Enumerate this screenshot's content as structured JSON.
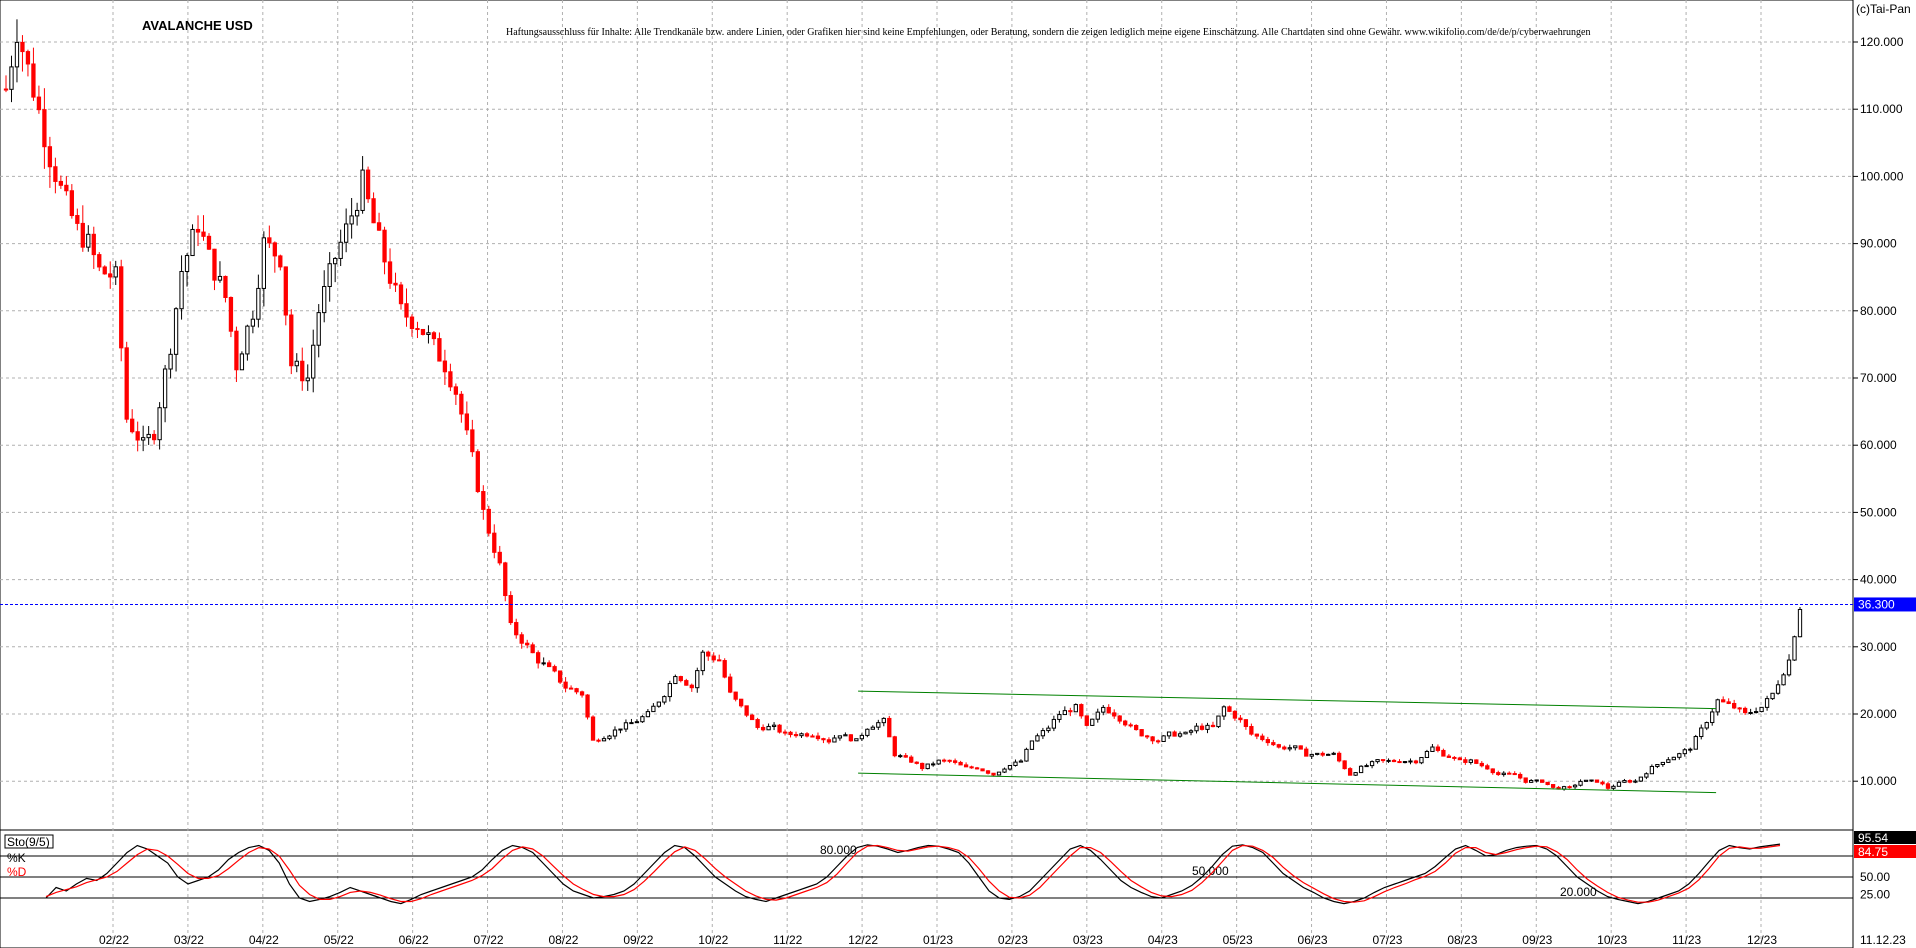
{
  "chart_data": [
    {
      "type": "candlestick",
      "title": "AVALANCHE USD",
      "copyright": "(c)Tai-Pan",
      "disclaimer": "Haftungsausschluss für Inhalte: Alle Trendkanäle bzw. andere Linien, oder Grafiken hier sind keine Empfehlungen, oder Beratung, sondern die zeigen lediglich meine eigene Einschätzung. Alle Chartdaten sind ohne Gewähr. www.wikifolio.com/de/de/p/cyberwaehrungen",
      "y_ticks": [
        "120.000",
        "110.000",
        "100.000",
        "90.000",
        "80.000",
        "70.000",
        "60.000",
        "50.000",
        "40.000",
        "30.000",
        "20.000",
        "10.000"
      ],
      "ylim": [
        0,
        125
      ],
      "x_ticks": [
        "02/22",
        "03/22",
        "04/22",
        "05/22",
        "06/22",
        "07/22",
        "08/22",
        "09/22",
        "10/22",
        "11/22",
        "12/22",
        "01/23",
        "02/23",
        "03/23",
        "04/23",
        "05/23",
        "06/23",
        "07/23",
        "08/23",
        "09/23",
        "10/23",
        "11/23",
        "12/23"
      ],
      "last_date": "11.12.23",
      "current_price": "36.300",
      "current_price_value": 36.3,
      "up_color": "#000000",
      "down_color": "#ff0000",
      "price_line_color": "#0000ff",
      "price_label_bg": "#0000ff",
      "trendline_color": "#008000",
      "trendlines": [
        {
          "x": [
            "12/22",
            "11/23"
          ],
          "y": [
            23.4,
            20.8
          ]
        },
        {
          "x": [
            "12/22",
            "11/23"
          ],
          "y": [
            11.2,
            8.3
          ]
        }
      ],
      "price_path": [
        [
          0,
          113
        ],
        [
          2,
          122
        ],
        [
          5,
          113
        ],
        [
          8,
          103
        ],
        [
          10,
          98
        ],
        [
          13,
          92
        ],
        [
          15,
          90
        ],
        [
          17,
          86
        ],
        [
          20,
          85
        ],
        [
          22,
          64
        ],
        [
          25,
          60
        ],
        [
          27,
          62
        ],
        [
          30,
          75
        ],
        [
          32,
          86
        ],
        [
          35,
          93
        ],
        [
          37,
          88
        ],
        [
          40,
          82
        ],
        [
          42,
          72
        ],
        [
          45,
          80
        ],
        [
          47,
          90
        ],
        [
          50,
          88
        ],
        [
          52,
          72
        ],
        [
          55,
          70
        ],
        [
          57,
          80
        ],
        [
          60,
          88
        ],
        [
          62,
          92
        ],
        [
          65,
          99
        ],
        [
          67,
          93
        ],
        [
          70,
          85
        ],
        [
          72,
          80
        ],
        [
          75,
          78
        ],
        [
          77,
          76
        ],
        [
          80,
          72
        ],
        [
          82,
          68
        ],
        [
          85,
          58
        ],
        [
          87,
          50
        ],
        [
          90,
          42
        ],
        [
          92,
          33
        ],
        [
          95,
          30
        ],
        [
          97,
          28
        ],
        [
          100,
          26
        ],
        [
          102,
          24
        ],
        [
          105,
          23
        ],
        [
          107,
          16
        ],
        [
          110,
          17
        ],
        [
          112,
          18
        ],
        [
          115,
          19
        ],
        [
          117,
          20
        ],
        [
          120,
          23
        ],
        [
          122,
          26
        ],
        [
          125,
          24
        ],
        [
          127,
          29
        ],
        [
          130,
          28
        ],
        [
          132,
          23
        ],
        [
          135,
          20
        ],
        [
          137,
          18
        ],
        [
          140,
          18
        ],
        [
          142,
          17
        ],
        [
          145,
          17
        ],
        [
          147,
          17
        ],
        [
          150,
          16
        ],
        [
          152,
          17
        ],
        [
          155,
          16
        ],
        [
          157,
          18
        ],
        [
          160,
          19
        ],
        [
          162,
          14
        ],
        [
          165,
          13
        ],
        [
          167,
          12
        ],
        [
          170,
          13
        ],
        [
          172,
          13
        ],
        [
          175,
          12
        ],
        [
          177,
          12
        ],
        [
          180,
          11
        ],
        [
          182,
          12
        ],
        [
          185,
          13
        ],
        [
          187,
          16
        ],
        [
          190,
          18
        ],
        [
          192,
          20
        ],
        [
          195,
          21
        ],
        [
          197,
          18
        ],
        [
          200,
          21
        ],
        [
          202,
          20
        ],
        [
          205,
          18
        ],
        [
          207,
          17
        ],
        [
          210,
          16
        ],
        [
          212,
          17
        ],
        [
          215,
          17
        ],
        [
          217,
          18
        ],
        [
          220,
          18
        ],
        [
          222,
          21
        ],
        [
          225,
          19
        ],
        [
          227,
          17
        ],
        [
          230,
          16
        ],
        [
          232,
          15
        ],
        [
          235,
          15
        ],
        [
          237,
          14
        ],
        [
          240,
          14
        ],
        [
          242,
          14
        ],
        [
          245,
          11
        ],
        [
          247,
          12
        ],
        [
          250,
          13
        ],
        [
          252,
          13
        ],
        [
          255,
          13
        ],
        [
          257,
          13
        ],
        [
          260,
          15
        ],
        [
          262,
          14
        ],
        [
          265,
          13
        ],
        [
          267,
          13
        ],
        [
          270,
          12
        ],
        [
          272,
          11
        ],
        [
          275,
          11
        ],
        [
          277,
          10
        ],
        [
          280,
          10
        ],
        [
          282,
          9
        ],
        [
          285,
          9
        ],
        [
          287,
          10
        ],
        [
          290,
          10
        ],
        [
          292,
          9
        ],
        [
          295,
          10
        ],
        [
          297,
          10
        ],
        [
          300,
          12
        ],
        [
          302,
          13
        ],
        [
          305,
          14
        ],
        [
          307,
          15
        ],
        [
          310,
          19
        ],
        [
          312,
          22
        ],
        [
          315,
          21
        ],
        [
          317,
          20
        ],
        [
          320,
          21
        ],
        [
          322,
          23
        ],
        [
          325,
          28
        ],
        [
          327,
          36
        ]
      ],
      "candle_count": 328
    },
    {
      "type": "line",
      "indicator": "Sto(9/5)",
      "series": [
        {
          "name": "%K",
          "color": "#000000",
          "values": [
            20,
            35,
            30,
            40,
            48,
            45,
            55,
            70,
            85,
            95,
            90,
            80,
            70,
            50,
            40,
            45,
            50,
            60,
            75,
            85,
            92,
            95,
            88,
            70,
            40,
            20,
            15,
            18,
            22,
            28,
            35,
            30,
            25,
            20,
            15,
            12,
            18,
            25,
            30,
            35,
            40,
            45,
            50,
            60,
            75,
            88,
            95,
            92,
            85,
            70,
            55,
            40,
            30,
            25,
            20,
            22,
            25,
            30,
            40,
            55,
            70,
            85,
            95,
            92,
            80,
            65,
            50,
            40,
            30,
            22,
            18,
            15,
            20,
            25,
            30,
            35,
            40,
            50,
            65,
            80,
            92,
            96,
            94,
            90,
            85,
            88,
            92,
            95,
            94,
            90,
            85,
            70,
            50,
            30,
            20,
            18,
            22,
            30,
            45,
            60,
            75,
            90,
            95,
            88,
            75,
            60,
            45,
            35,
            28,
            22,
            20,
            25,
            30,
            38,
            50,
            65,
            82,
            94,
            96,
            92,
            85,
            70,
            55,
            45,
            35,
            28,
            20,
            15,
            12,
            15,
            20,
            28,
            35,
            40,
            45,
            50,
            55,
            65,
            78,
            90,
            95,
            88,
            80,
            82,
            88,
            92,
            94,
            95,
            90,
            80,
            65,
            50,
            40,
            30,
            22,
            18,
            15,
            12,
            15,
            20,
            25,
            30,
            40,
            55,
            72,
            88,
            95,
            92,
            90,
            93,
            95,
            97
          ]
        },
        {
          "name": "%D",
          "color": "#ff0000",
          "values": [
            22,
            28,
            32,
            36,
            42,
            46,
            50,
            58,
            70,
            82,
            90,
            88,
            80,
            68,
            55,
            48,
            48,
            52,
            62,
            74,
            85,
            92,
            90,
            80,
            60,
            38,
            25,
            18,
            18,
            22,
            28,
            30,
            28,
            24,
            19,
            15,
            15,
            19,
            25,
            30,
            35,
            40,
            45,
            52,
            62,
            76,
            88,
            93,
            90,
            80,
            66,
            52,
            40,
            32,
            25,
            22,
            22,
            25,
            32,
            44,
            58,
            73,
            86,
            93,
            88,
            76,
            62,
            50,
            40,
            30,
            23,
            18,
            17,
            20,
            25,
            30,
            35,
            42,
            54,
            70,
            85,
            94,
            95,
            92,
            88,
            87,
            90,
            93,
            94,
            92,
            88,
            78,
            62,
            44,
            30,
            21,
            20,
            24,
            35,
            50,
            65,
            80,
            92,
            92,
            85,
            72,
            58,
            45,
            36,
            28,
            23,
            22,
            25,
            31,
            42,
            56,
            72,
            88,
            95,
            94,
            88,
            78,
            64,
            52,
            42,
            34,
            26,
            19,
            15,
            14,
            16,
            22,
            29,
            35,
            40,
            46,
            51,
            58,
            70,
            84,
            92,
            92,
            85,
            82,
            85,
            89,
            92,
            94,
            93,
            86,
            75,
            60,
            47,
            37,
            28,
            21,
            17,
            14,
            14,
            17,
            22,
            27,
            34,
            46,
            62,
            80,
            91,
            93,
            91,
            91,
            93,
            95
          ]
        }
      ],
      "ylim": [
        0,
        110
      ],
      "levels": [
        {
          "value": 80,
          "label": "80.000"
        },
        {
          "value": 50,
          "label": "50.000"
        },
        {
          "value": 20,
          "label": "20.000"
        }
      ],
      "y_ticks": [
        "50.00",
        "25.00"
      ],
      "k_label": "%K",
      "d_label": "%D",
      "last_k": "95.54",
      "last_d": "84.75"
    }
  ]
}
